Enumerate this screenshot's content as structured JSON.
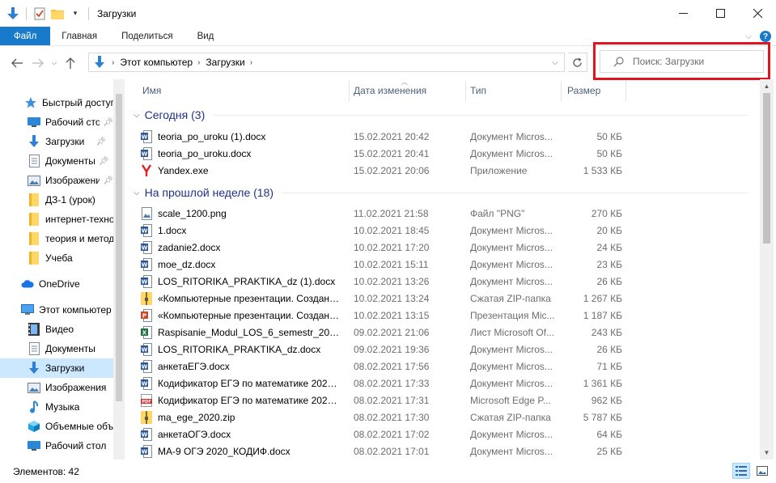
{
  "window": {
    "title": "Загрузки"
  },
  "ribbon": {
    "tabs": [
      "Файл",
      "Главная",
      "Поделиться",
      "Вид"
    ]
  },
  "address": {
    "crumbs": [
      "Этот компьютер",
      "Загрузки"
    ]
  },
  "search": {
    "placeholder": "Поиск: Загрузки"
  },
  "sidebar": {
    "items": [
      {
        "label": "Быстрый доступ",
        "icon": "star-icon",
        "pinned": false
      },
      {
        "label": "Рабочий сто",
        "icon": "desktop-icon",
        "pinned": true
      },
      {
        "label": "Загрузки",
        "icon": "download-icon",
        "pinned": true
      },
      {
        "label": "Документы",
        "icon": "documents-icon",
        "pinned": true
      },
      {
        "label": "Изображени",
        "icon": "pictures-icon",
        "pinned": true
      },
      {
        "label": "ДЗ-1 (урок)",
        "icon": "folder-icon",
        "pinned": false
      },
      {
        "label": "интернет-техно",
        "icon": "folder-icon",
        "pinned": false
      },
      {
        "label": "теория и метод",
        "icon": "folder-icon",
        "pinned": false
      },
      {
        "label": "Учеба",
        "icon": "folder-icon",
        "pinned": false
      },
      {
        "label": "OneDrive",
        "icon": "cloud-icon",
        "pinned": false
      },
      {
        "label": "Этот компьютер",
        "icon": "computer-icon",
        "pinned": false
      },
      {
        "label": "Видео",
        "icon": "video-icon",
        "pinned": false
      },
      {
        "label": "Документы",
        "icon": "documents-icon",
        "pinned": false
      },
      {
        "label": "Загрузки",
        "icon": "download-icon",
        "pinned": false
      },
      {
        "label": "Изображения",
        "icon": "pictures-icon",
        "pinned": false
      },
      {
        "label": "Музыка",
        "icon": "music-icon",
        "pinned": false
      },
      {
        "label": "Объемные объ",
        "icon": "3d-objects-icon",
        "pinned": false
      },
      {
        "label": "Рабочий стол",
        "icon": "desktop-icon",
        "pinned": false
      }
    ]
  },
  "columns": {
    "name": "Имя",
    "date": "Дата изменения",
    "type": "Тип",
    "size": "Размер"
  },
  "groups": {
    "today": "Сегодня (3)",
    "last_week": "На прошлой неделе (18)"
  },
  "files_today": [
    {
      "name": "teoria_po_uroku (1).docx",
      "date": "15.02.2021 20:42",
      "type": "Документ Micros...",
      "size": "50 КБ",
      "icon": "word-icon"
    },
    {
      "name": "teoria_po_uroku.docx",
      "date": "15.02.2021 20:41",
      "type": "Документ Micros...",
      "size": "50 КБ",
      "icon": "word-icon"
    },
    {
      "name": "Yandex.exe",
      "date": "15.02.2021 20:06",
      "type": "Приложение",
      "size": "1 533 КБ",
      "icon": "yandex-icon"
    }
  ],
  "files_week": [
    {
      "name": "scale_1200.png",
      "date": "11.02.2021 21:58",
      "type": "Файл \"PNG\"",
      "size": "270 КБ",
      "icon": "image-file-icon"
    },
    {
      "name": "1.docx",
      "date": "10.02.2021 18:45",
      "type": "Документ Micros...",
      "size": "20 КБ",
      "icon": "word-icon"
    },
    {
      "name": "zadanie2.docx",
      "date": "10.02.2021 17:20",
      "type": "Документ Micros...",
      "size": "24 КБ",
      "icon": "word-icon"
    },
    {
      "name": "moe_dz.docx",
      "date": "10.02.2021 15:11",
      "type": "Документ Micros...",
      "size": "23 КБ",
      "icon": "word-icon"
    },
    {
      "name": "LOS_RITORIKA_PRAKTIKA_dz (1).docx",
      "date": "10.02.2021 13:26",
      "type": "Документ Micros...",
      "size": "26 КБ",
      "icon": "word-icon"
    },
    {
      "name": "«Компьютерные презентации. Создани...",
      "date": "10.02.2021 13:24",
      "type": "Сжатая ZIP-папка",
      "size": "1 267 КБ",
      "icon": "zip-icon"
    },
    {
      "name": "«Компьютерные презентации. Создани...",
      "date": "10.02.2021 13:15",
      "type": "Презентация Mic...",
      "size": "1 187 КБ",
      "icon": "powerpoint-icon"
    },
    {
      "name": "Raspisanie_Modul_LOS_6_semestr_2020-...",
      "date": "09.02.2021 21:06",
      "type": "Лист Microsoft Of...",
      "size": "243 КБ",
      "icon": "excel-icon"
    },
    {
      "name": "LOS_RITORIKA_PRAKTIKA_dz.docx",
      "date": "09.02.2021 19:36",
      "type": "Документ Micros...",
      "size": "26 КБ",
      "icon": "word-icon"
    },
    {
      "name": "анкетаЕГЭ.docx",
      "date": "08.02.2021 17:56",
      "type": "Документ Micros...",
      "size": "71 КБ",
      "icon": "word-icon"
    },
    {
      "name": "Кодификатор ЕГЭ по математике 2020....",
      "date": "08.02.2021 17:33",
      "type": "Документ Micros...",
      "size": "1 361 КБ",
      "icon": "word-icon"
    },
    {
      "name": "Кодификатор ЕГЭ по математике 2020....",
      "date": "08.02.2021 17:31",
      "type": "Microsoft Edge P...",
      "size": "962 КБ",
      "icon": "pdf-icon"
    },
    {
      "name": "ma_ege_2020.zip",
      "date": "08.02.2021 17:30",
      "type": "Сжатая ZIP-папка",
      "size": "5 787 КБ",
      "icon": "zip-icon"
    },
    {
      "name": "анкетаОГЭ.docx",
      "date": "08.02.2021 17:02",
      "type": "Документ Micros...",
      "size": "64 КБ",
      "icon": "word-icon"
    },
    {
      "name": "МА-9 ОГЭ 2020_КОДИФ.docx",
      "date": "08.02.2021 17:01",
      "type": "Документ Micros...",
      "size": "25 КБ",
      "icon": "word-icon"
    }
  ],
  "status": {
    "count": "Элементов: 42"
  },
  "colors": {
    "accent": "#1979ca",
    "selected": "#cce8ff",
    "group_header": "#1e3287",
    "highlight": "#e0151f"
  }
}
